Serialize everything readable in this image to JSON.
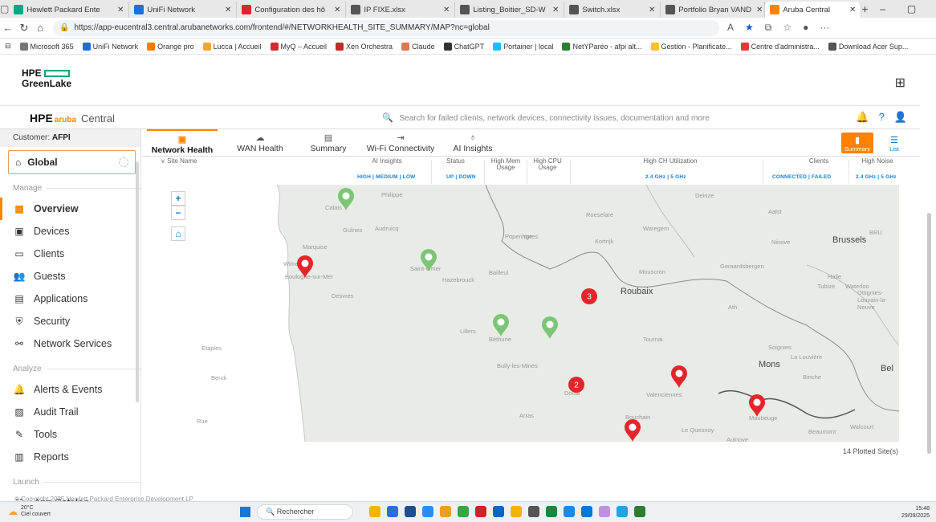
{
  "browser": {
    "tabs": [
      {
        "label": "Hewlett Packard Ente",
        "color": "#01a982"
      },
      {
        "label": "UniFi Network",
        "color": "#1e6fd9"
      },
      {
        "label": "Configuration des hô",
        "color": "#d9272e"
      },
      {
        "label": "IP FIXE.xlsx",
        "color": "#555555"
      },
      {
        "label": "Listing_Boitier_SD-W",
        "color": "#555555"
      },
      {
        "label": "Switch.xlsx",
        "color": "#555555"
      },
      {
        "label": "Portfolio Bryan VAND",
        "color": "#555555"
      },
      {
        "label": "Aruba Central",
        "color": "#ff8300"
      }
    ],
    "url": "https://app-eucentral3.central.arubanetworks.com/frontend/#/NETWORKHEALTH_SITE_SUMMARY/MAP?nc=global",
    "bookmarks": [
      {
        "label": "Microsoft 365",
        "color": "#777777"
      },
      {
        "label": "UniFi Network",
        "color": "#1e6fd9"
      },
      {
        "label": "Orange pro",
        "color": "#ff7900"
      },
      {
        "label": "Lucca | Accueil",
        "color": "#f5a623"
      },
      {
        "label": "MyQ – Accueil",
        "color": "#d9272e"
      },
      {
        "label": "Xen Orchestra",
        "color": "#c62828"
      },
      {
        "label": "Claude",
        "color": "#d97757"
      },
      {
        "label": "ChatGPT",
        "color": "#333333"
      },
      {
        "label": "Portainer | local",
        "color": "#13bef9"
      },
      {
        "label": "NetYParéo - afpi alt...",
        "color": "#2e7d32"
      },
      {
        "label": "Gestion - Planificate...",
        "color": "#fbc02d"
      },
      {
        "label": "Centre d'administra...",
        "color": "#e53935"
      },
      {
        "label": "Download Acer Sup...",
        "color": "#555555"
      }
    ]
  },
  "greenlake": {
    "logo_line1": "HPE",
    "logo_line2": "GreenLake"
  },
  "central": {
    "logo": "HPE",
    "aruba": "aruba",
    "product": "Central",
    "search_placeholder": "Search for failed clients, network devices, connectivity issues, documentation and more"
  },
  "sidebar": {
    "customer_label": "Customer:",
    "customer_name": "AFPI",
    "scope": "Global",
    "manage_header": "Manage",
    "manage_items": [
      {
        "label": "Overview",
        "icon": "grid-icon",
        "glyph": "▦",
        "active": true
      },
      {
        "label": "Devices",
        "icon": "devices-icon",
        "glyph": "▣"
      },
      {
        "label": "Clients",
        "icon": "clients-icon",
        "glyph": "▭"
      },
      {
        "label": "Guests",
        "icon": "guests-icon",
        "glyph": "👥"
      },
      {
        "label": "Applications",
        "icon": "applications-icon",
        "glyph": "▤"
      },
      {
        "label": "Security",
        "icon": "shield-icon",
        "glyph": "⛨"
      },
      {
        "label": "Network Services",
        "icon": "network-services-icon",
        "glyph": "⚯"
      }
    ],
    "analyze_header": "Analyze",
    "analyze_items": [
      {
        "label": "Alerts & Events",
        "icon": "bell-icon",
        "glyph": "🔔"
      },
      {
        "label": "Audit Trail",
        "icon": "audit-icon",
        "glyph": "▨"
      },
      {
        "label": "Tools",
        "icon": "tools-icon",
        "glyph": "✎"
      },
      {
        "label": "Reports",
        "icon": "reports-icon",
        "glyph": "▥"
      }
    ],
    "launch_header": "Launch",
    "launch_items": [
      {
        "label": "App Catalog",
        "icon": "catalog-icon",
        "glyph": "☷"
      }
    ]
  },
  "tabs": [
    {
      "label": "Network Health",
      "icon": "health-icon",
      "glyph": "▣",
      "active": true
    },
    {
      "label": "WAN Health",
      "icon": "cloud-icon",
      "glyph": "☁"
    },
    {
      "label": "Summary",
      "icon": "summary-icon",
      "glyph": "▤"
    },
    {
      "label": "Wi-Fi Connectivity",
      "icon": "wifi-icon",
      "glyph": "⇥"
    },
    {
      "label": "AI Insights",
      "icon": "bulb-icon",
      "glyph": "♁"
    }
  ],
  "view_toggle": [
    {
      "label": "Summary",
      "glyph": "▮",
      "on": true
    },
    {
      "label": "List",
      "glyph": "☰",
      "on": false
    }
  ],
  "columns": {
    "site_name": "Site Name",
    "ai_insights": "AI Insights",
    "ai_insights_sub": "HIGH | MEDIUM | LOW",
    "status": "Status",
    "status_sub": "UP | DOWN",
    "high_mem": "High Mem Usage",
    "high_cpu": "High CPU Usage",
    "high_ch": "High CH Utilization",
    "high_ch_sub": "2.4 GHz | 5 GHz",
    "clients": "Clients",
    "clients_sub": "CONNECTED | FAILED",
    "high_noise": "High Noise",
    "high_noise_sub": "2.4 GHz | 5 GHz"
  },
  "map": {
    "places": [
      {
        "name": "Philippe"
      },
      {
        "name": "Calais"
      },
      {
        "name": "Guînes"
      },
      {
        "name": "Audruicq"
      },
      {
        "name": "Marquise"
      },
      {
        "name": "Wimereux"
      },
      {
        "name": "Boulogne-sur-Mer"
      },
      {
        "name": "Desvres"
      },
      {
        "name": "Saint-Omer"
      },
      {
        "name": "Hazebrouck"
      },
      {
        "name": "Bailleul"
      },
      {
        "name": "Poperinge"
      },
      {
        "name": "Ypres"
      },
      {
        "name": "Roeselare"
      },
      {
        "name": "Kortrijk"
      },
      {
        "name": "Waregem"
      },
      {
        "name": "Deinze"
      },
      {
        "name": "Aalst"
      },
      {
        "name": "Ninove"
      },
      {
        "name": "Brussels"
      },
      {
        "name": "BRU"
      },
      {
        "name": "Geraardsbergen"
      },
      {
        "name": "Mouscron"
      },
      {
        "name": "Roubaix"
      },
      {
        "name": "Tournai"
      },
      {
        "name": "Ath"
      },
      {
        "name": "Halle"
      },
      {
        "name": "Tubize"
      },
      {
        "name": "Waterloo"
      },
      {
        "name": "Ottignies-Louvain-la-Neuve"
      },
      {
        "name": "Soignies"
      },
      {
        "name": "La Louvière"
      },
      {
        "name": "Mons"
      },
      {
        "name": "Binche"
      },
      {
        "name": "Bel"
      },
      {
        "name": "Lillers"
      },
      {
        "name": "Béthune"
      },
      {
        "name": "Bully-les-Mines"
      },
      {
        "name": "Douai"
      },
      {
        "name": "Valenciennes"
      },
      {
        "name": "Arras"
      },
      {
        "name": "Bouchain"
      },
      {
        "name": "Le Quesnoy"
      },
      {
        "name": "Maubeuge"
      },
      {
        "name": "Aulnoye"
      },
      {
        "name": "Beaumont"
      },
      {
        "name": "Walcourt"
      },
      {
        "name": "Etaples"
      },
      {
        "name": "Berck"
      },
      {
        "name": "Rue"
      }
    ],
    "pins": [
      {
        "status": "up"
      },
      {
        "status": "down"
      },
      {
        "status": "up"
      },
      {
        "status": "up"
      },
      {
        "status": "up"
      },
      {
        "status": "down"
      },
      {
        "status": "down"
      },
      {
        "status": "down"
      }
    ],
    "clusters": [
      {
        "count": "3"
      },
      {
        "count": "2"
      }
    ],
    "controls": {
      "zoom_in": "+",
      "zoom_out": "−",
      "home": "⌂"
    }
  },
  "plotted_sites": "14 Plotted Site(s)",
  "footer": "© Copyright 2025 Hewlett Packard Enterprise Development LP",
  "taskbar": {
    "temperature": "20°C",
    "weather": "Ciel couvert",
    "search": "Rechercher",
    "time": "15:48",
    "date": "29/09/2025"
  },
  "colors": {
    "accent": "#ff8300",
    "link": "#0a78c8",
    "pin_up": "#7cc576",
    "pin_down": "#e5252b"
  }
}
